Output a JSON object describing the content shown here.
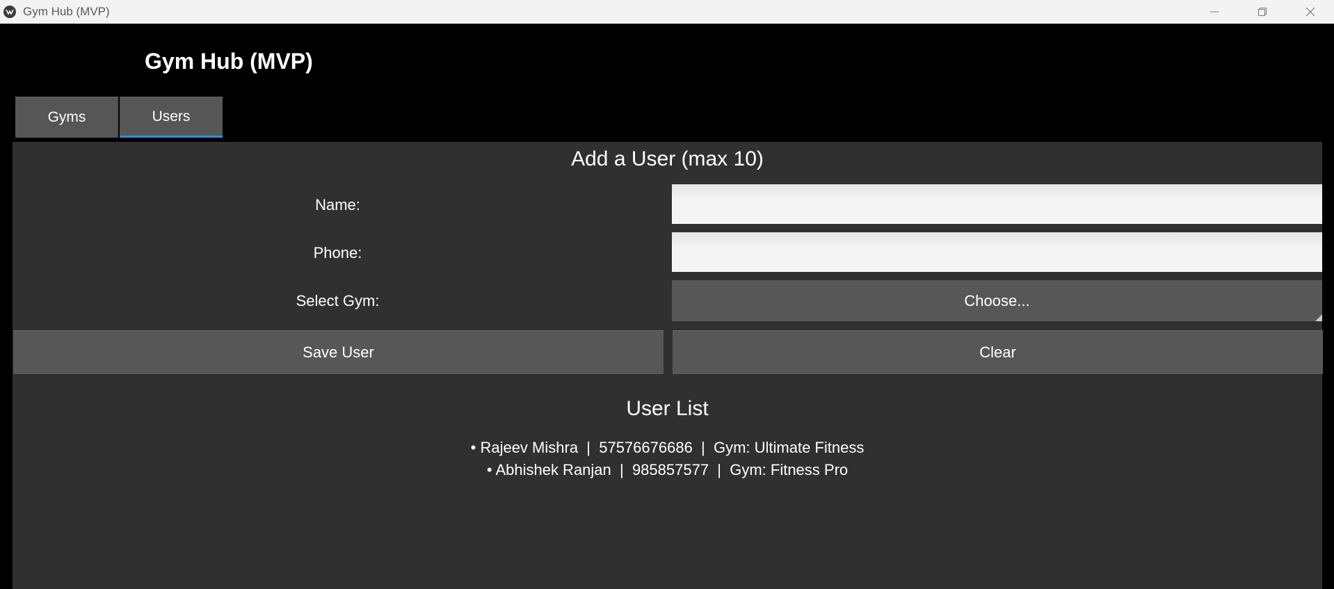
{
  "window": {
    "title": "Gym Hub (MVP)"
  },
  "app": {
    "title": "Gym Hub (MVP)"
  },
  "tabs": [
    {
      "label": "Gyms",
      "active": false
    },
    {
      "label": "Users",
      "active": true
    }
  ],
  "form": {
    "title": "Add a User (max 10)",
    "name_label": "Name:",
    "name_value": "",
    "phone_label": "Phone:",
    "phone_value": "",
    "gym_label": "Select Gym:",
    "gym_select_text": "Choose...",
    "save_label": "Save User",
    "clear_label": "Clear"
  },
  "user_list": {
    "title": "User List",
    "items": [
      "• Rajeev Mishra  |  57576676686  |  Gym: Ultimate Fitness",
      "• Abhishek Ranjan  |  985857577  |  Gym: Fitness Pro"
    ]
  },
  "icons": {
    "app": "app-logo-icon",
    "minimize": "minimize-icon",
    "restore": "restore-icon",
    "close": "close-icon"
  },
  "colors": {
    "background": "#000000",
    "panel": "#303030",
    "button": "#575757",
    "tab_active_indicator": "#2f8fd6",
    "input": "#f4f4f4"
  }
}
